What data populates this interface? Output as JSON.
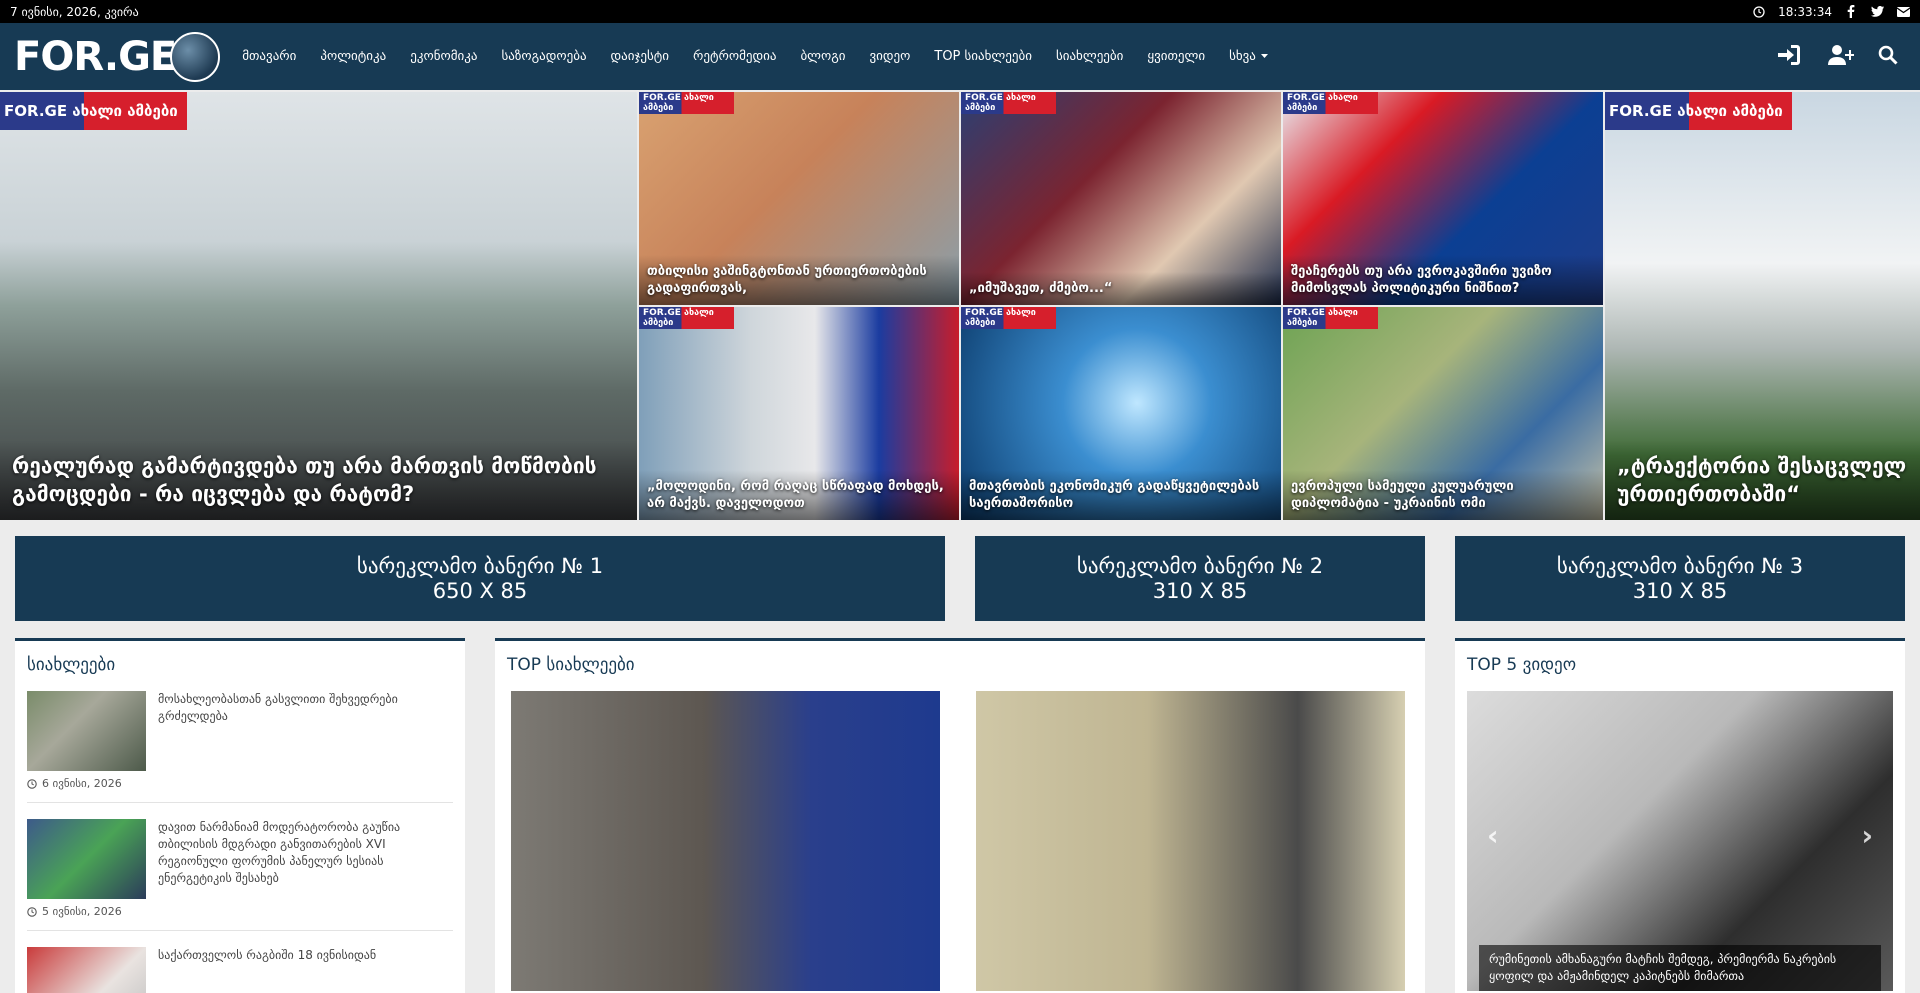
{
  "topbar": {
    "date": "7 ივნისი, 2026, კვირა",
    "time": "18:33:34"
  },
  "nav": {
    "logo_text": "FOR.GE",
    "menu": [
      "მთავარი",
      "პოლიტიკა",
      "ეკონომიკა",
      "საზოგადოება",
      "დაიჯესტი",
      "რეტრომედია",
      "ბლოგი",
      "ვიდეო",
      "TOP სიახლეები",
      "სიახლეები",
      "ყვითელი",
      "სხვა"
    ]
  },
  "hero": {
    "badge_text": "FOR.GE ახალი ამბები",
    "big_left_caption": "რეალურად გამარტივდება თუ არა მართვის მოწმობის გამოცდები - რა იცვლება და რატომ?",
    "big_right_caption": "„ტრაექტორია შესაცვლელ ურთიერთობაში“",
    "tiles": [
      {
        "caption": "თბილისი ვაშინგტონთან ურთიერთობების გადაფირთვას,"
      },
      {
        "caption": "„იმუშავეთ, ძმებო...“"
      },
      {
        "caption": "შეაჩერებს თუ არა ევროკავშირი უვიზო მიმოსვლას პოლიტიკური ნიშნით?"
      },
      {
        "caption": "„მოლოდინი, რომ რაღაც სწრაფად მოხდეს, არ მაქვს. დაველოდოთ"
      },
      {
        "caption": "მთავრობის ეკონომიკურ გადაწყვეტილებას საერთაშორისო"
      },
      {
        "caption": "ევროპული სამეული კულუარული დიპლომატია - უკრაინის ომი"
      }
    ]
  },
  "banners": [
    {
      "line1": "სარეკლამო ბანერი № 1",
      "line2": "650 X 85"
    },
    {
      "line1": "სარეკლამო ბანერი № 2",
      "line2": "310 X 85"
    },
    {
      "line1": "სარეკლამო ბანერი № 3",
      "line2": "310 X 85"
    }
  ],
  "news": {
    "title": "სიახლეები",
    "items": [
      {
        "text": "მოსახლეობასთან გასვლითი შეხვედრები გრძელდება",
        "date": "6 ივნისი, 2026"
      },
      {
        "text": "დავით ნარმანიამ მოდერატორობა გაუწია თბილისის მდგრადი განვითარების XVI რეგიონული ფორუმის პანელურ სესიას ენერგეტიკის შესახებ",
        "date": "5 ივნისი, 2026"
      },
      {
        "text": "საქართველოს რაგბიში 18 ივნისიდან",
        "date": ""
      }
    ]
  },
  "top_news": {
    "title": "TOP სიახლეები"
  },
  "top_video": {
    "title": "TOP 5 ვიდეო",
    "caption": "რუმინეთის ამხანაგური მატჩის შემდეგ, პრემიერმა ნაკრების ყოფილ და ამჟამინდელ კაპიტნებს მიმართა"
  }
}
